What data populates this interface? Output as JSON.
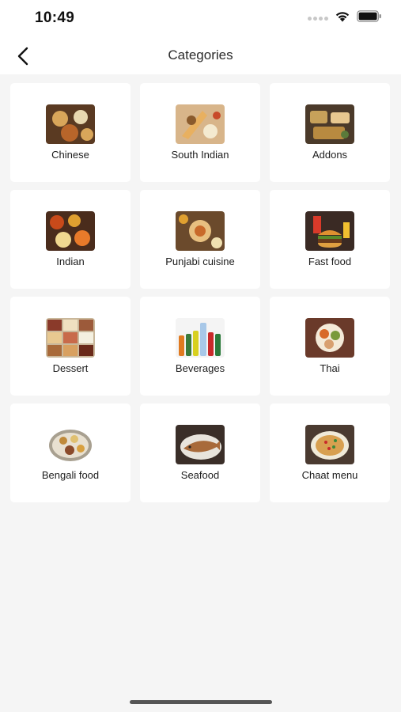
{
  "status_bar": {
    "time": "10:49"
  },
  "header": {
    "title": "Categories",
    "back_icon": "chevron-left-icon"
  },
  "categories": [
    {
      "name": "Chinese",
      "bg": "#5a3a22",
      "accent": "#d9a65a"
    },
    {
      "name": "South Indian",
      "bg": "#d8b58a",
      "accent": "#8a5a2c"
    },
    {
      "name": "Addons",
      "bg": "#4b3a2a",
      "accent": "#c7a15a"
    },
    {
      "name": "Indian",
      "bg": "#4a2c1c",
      "accent": "#e0a030"
    },
    {
      "name": "Punjabi cuisine",
      "bg": "#6b4a2c",
      "accent": "#e8c080"
    },
    {
      "name": "Fast food",
      "bg": "#3a2a24",
      "accent": "#e09030"
    },
    {
      "name": "Dessert",
      "bg": "#c9b79a",
      "accent": "#9c5a3a"
    },
    {
      "name": "Beverages",
      "bg": "#f4f4f4",
      "accent": "#3a7a3a"
    },
    {
      "name": "Thai",
      "bg": "#6a3a2a",
      "accent": "#d8a070"
    },
    {
      "name": "Bengali food",
      "bg": "#ffffff",
      "accent": "#c08a3a"
    },
    {
      "name": "Seafood",
      "bg": "#3a2e28",
      "accent": "#a86a3a"
    },
    {
      "name": "Chaat menu",
      "bg": "#4a3a30",
      "accent": "#d8a050"
    }
  ]
}
